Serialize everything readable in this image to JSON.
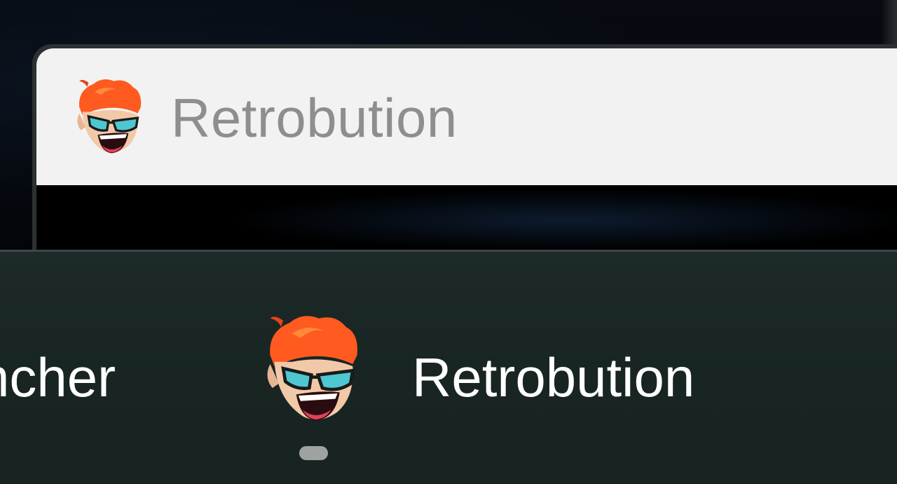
{
  "window": {
    "title": "Retrobution",
    "icon": "retrobution-app-icon"
  },
  "taskbar": {
    "items": [
      {
        "label": "ncher",
        "icon": null,
        "active": false
      },
      {
        "label": "Retrobution",
        "icon": "retrobution-app-icon",
        "active": true
      }
    ]
  },
  "colors": {
    "titlebar_bg": "#f2f2f2",
    "title_text": "#8e8e8e",
    "taskbar_bg": "#1b2827",
    "taskbar_text": "#ffffff",
    "indicator": "#9ea3a2"
  }
}
